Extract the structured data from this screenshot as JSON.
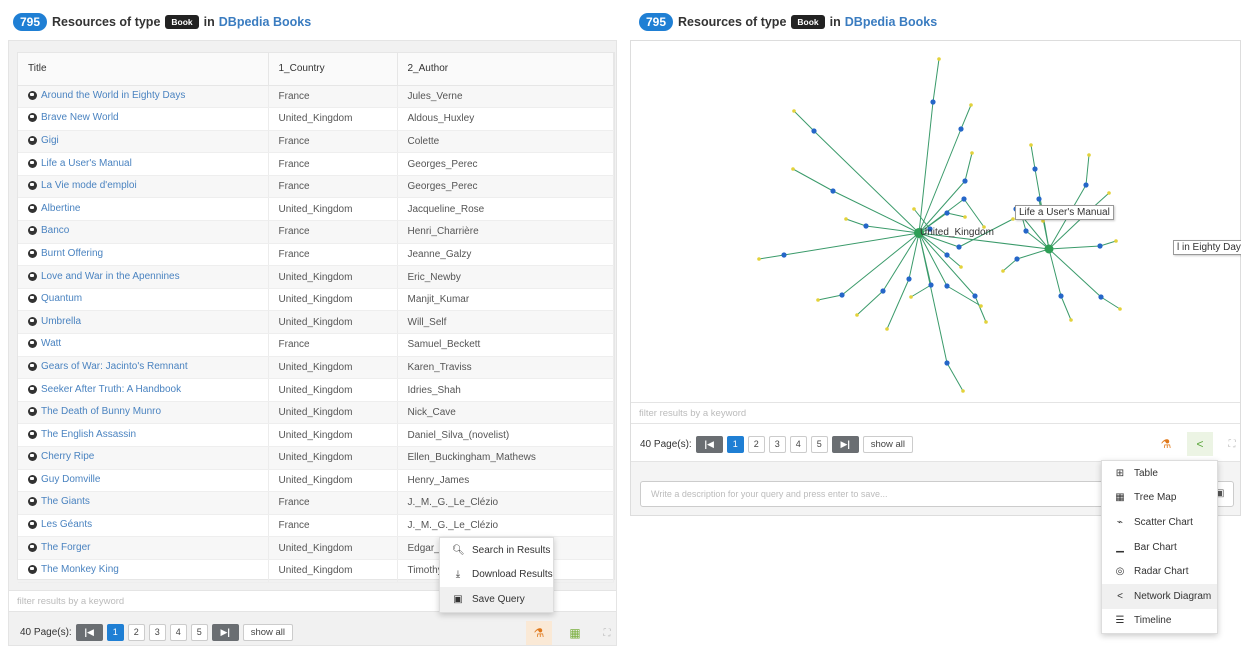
{
  "left": {
    "header": {
      "count": "795",
      "text1": "Resources of type",
      "type": "Book",
      "text2": "in",
      "dataset": "DBpedia Books"
    },
    "columns": [
      "Title",
      "1_Country",
      "2_Author"
    ],
    "rows": [
      [
        "Around the World in Eighty Days",
        "France",
        "Jules_Verne"
      ],
      [
        "Brave New World",
        "United_Kingdom",
        "Aldous_Huxley"
      ],
      [
        "Gigi",
        "France",
        "Colette"
      ],
      [
        "Life a User's Manual",
        "France",
        "Georges_Perec"
      ],
      [
        "La Vie mode d'emploi",
        "France",
        "Georges_Perec"
      ],
      [
        "Albertine",
        "United_Kingdom",
        "Jacqueline_Rose"
      ],
      [
        "Banco",
        "France",
        "Henri_Charrière"
      ],
      [
        "Burnt Offering",
        "France",
        "Jeanne_Galzy"
      ],
      [
        "Love and War in the Apennines",
        "United_Kingdom",
        "Eric_Newby"
      ],
      [
        "Quantum",
        "United_Kingdom",
        "Manjit_Kumar"
      ],
      [
        "Umbrella",
        "United_Kingdom",
        "Will_Self"
      ],
      [
        "Watt",
        "France",
        "Samuel_Beckett"
      ],
      [
        "Gears of War: Jacinto's Remnant",
        "United_Kingdom",
        "Karen_Traviss"
      ],
      [
        "Seeker After Truth: A Handbook",
        "United_Kingdom",
        "Idries_Shah"
      ],
      [
        "The Death of Bunny Munro",
        "United_Kingdom",
        "Nick_Cave"
      ],
      [
        "The English Assassin",
        "United_Kingdom",
        "Daniel_Silva_(novelist)"
      ],
      [
        "Cherry Ripe",
        "United_Kingdom",
        "Ellen_Buckingham_Mathews"
      ],
      [
        "Guy Domville",
        "United_Kingdom",
        "Henry_James"
      ],
      [
        "The Giants",
        "France",
        "J._M._G._Le_Clézio"
      ],
      [
        "Les Géants",
        "France",
        "J._M._G._Le_Clézio"
      ],
      [
        "The Forger",
        "United_Kingdom",
        "Edgar_V"
      ],
      [
        "The Monkey King",
        "United_Kingdom",
        "Timothy"
      ]
    ],
    "filter_placeholder": "filter results by a keyword",
    "pager": {
      "label": "40 Page(s):",
      "pages": [
        "1",
        "2",
        "3",
        "4",
        "5"
      ],
      "show_all": "show all"
    },
    "menu": [
      {
        "icon": "search-icon",
        "label": "Search in Results"
      },
      {
        "icon": "download-icon",
        "label": "Download Results"
      },
      {
        "icon": "save-icon",
        "label": "Save Query"
      }
    ]
  },
  "right": {
    "header": {
      "count": "795",
      "text1": "Resources of type",
      "type": "Book",
      "text2": "in",
      "dataset": "DBpedia Books"
    },
    "graph": {
      "label_uk": "United_Kingdom",
      "label_manual": "Life a User's Manual",
      "label_eighty": "l in Eighty Day"
    },
    "filter_placeholder": "filter results by a keyword",
    "pager": {
      "label": "40 Page(s):",
      "pages": [
        "1",
        "2",
        "3",
        "4",
        "5"
      ],
      "show_all": "show all"
    },
    "description_placeholder": "Write a description for your query and press enter to save...",
    "viz_menu": [
      {
        "icon": "table-icon",
        "label": "Table"
      },
      {
        "icon": "tree-map-icon",
        "label": "Tree Map"
      },
      {
        "icon": "scatter-chart-icon",
        "label": "Scatter Chart"
      },
      {
        "icon": "bar-chart-icon",
        "label": "Bar Chart"
      },
      {
        "icon": "radar-chart-icon",
        "label": "Radar Chart"
      },
      {
        "icon": "network-diagram-icon",
        "label": "Network Diagram"
      },
      {
        "icon": "timeline-icon",
        "label": "Timeline"
      }
    ]
  },
  "colors": {
    "accent": "#1f7fd4",
    "node_hub": "#2e9e55",
    "node_blue": "#2566c8",
    "node_yellow": "#e3d23a",
    "edge": "#3a9a6a"
  }
}
